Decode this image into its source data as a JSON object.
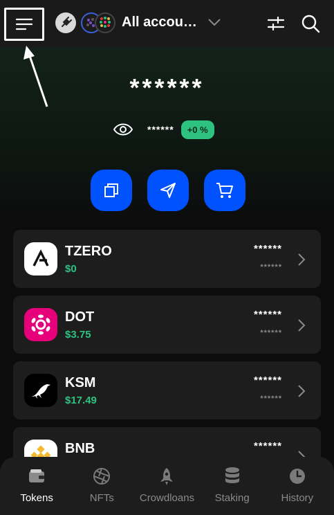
{
  "header": {
    "account_name": "All accou…",
    "icons": [
      "menu-icon",
      "plug-icon",
      "account-avatar",
      "chevron-down-icon",
      "sliders-icon",
      "search-icon"
    ]
  },
  "balance": {
    "total": "******",
    "sub": "******",
    "change": "+0 %"
  },
  "actions": [
    {
      "name": "copy-address",
      "icon": "copy-icon"
    },
    {
      "name": "send",
      "icon": "send-icon"
    },
    {
      "name": "buy",
      "icon": "cart-icon"
    }
  ],
  "tokens": [
    {
      "symbol": "TZERO",
      "price": "$0",
      "balance": "******",
      "value": "******",
      "logo_color": "#ffffff"
    },
    {
      "symbol": "DOT",
      "price": "$3.75",
      "balance": "******",
      "value": "******",
      "logo_color": "#e6007a"
    },
    {
      "symbol": "KSM",
      "price": "$17.49",
      "balance": "******",
      "value": "******",
      "logo_color": "#000000"
    },
    {
      "symbol": "BNB",
      "price": "",
      "balance": "******",
      "value": "",
      "logo_color": "#f3ba2f"
    }
  ],
  "nav": [
    {
      "label": "Tokens",
      "icon": "wallet-icon",
      "active": true
    },
    {
      "label": "NFTs",
      "icon": "aperture-icon",
      "active": false
    },
    {
      "label": "Crowdloans",
      "icon": "rocket-icon",
      "active": false
    },
    {
      "label": "Staking",
      "icon": "coins-icon",
      "active": false
    },
    {
      "label": "History",
      "icon": "clock-icon",
      "active": false
    }
  ],
  "colors": {
    "accent": "#0052ff",
    "positive": "#2ec281",
    "card": "#1d1d1d"
  }
}
